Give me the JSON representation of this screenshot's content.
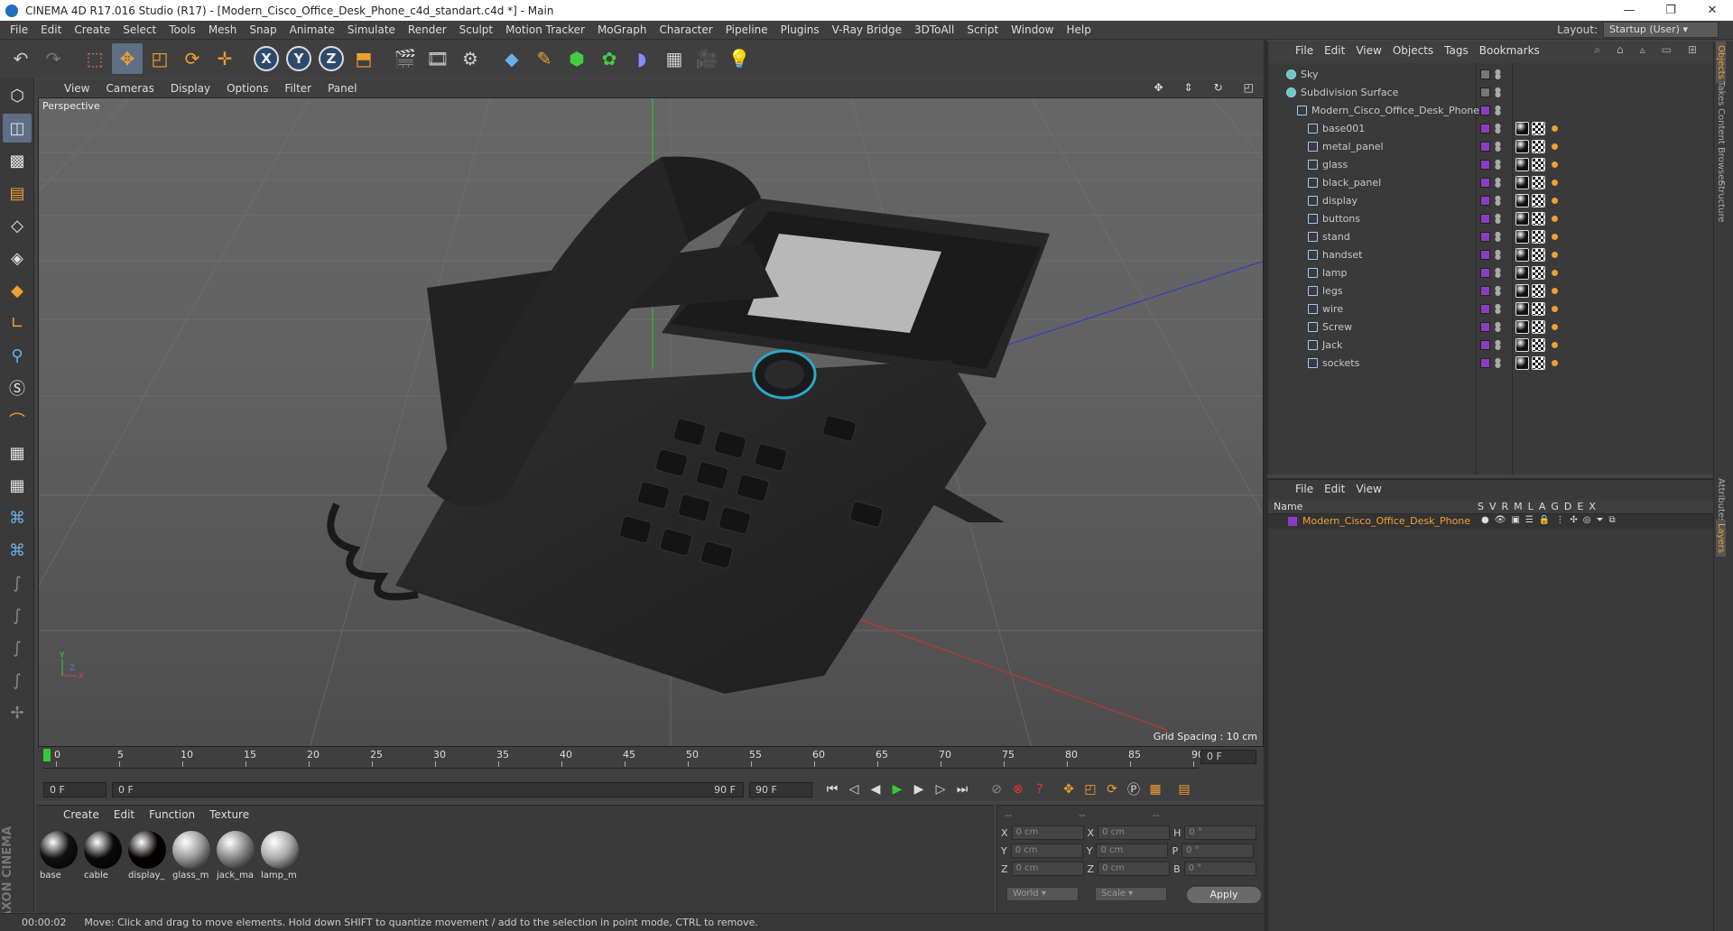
{
  "window": {
    "title": "CINEMA 4D R17.016 Studio (R17) - [Modern_Cisco_Office_Desk_Phone_c4d_standart.c4d *] - Main",
    "controls": [
      "—",
      "❐",
      "✕"
    ]
  },
  "menubar": {
    "items": [
      "File",
      "Edit",
      "Create",
      "Select",
      "Tools",
      "Mesh",
      "Snap",
      "Animate",
      "Simulate",
      "Render",
      "Sculpt",
      "Motion Tracker",
      "MoGraph",
      "Character",
      "Pipeline",
      "Plugins",
      "V-Ray Bridge",
      "3DToAll",
      "Script",
      "Window",
      "Help"
    ],
    "layout_label": "Layout:",
    "layout_value": "Startup (User)"
  },
  "toolbar": {
    "icons": [
      "undo-icon",
      "redo-icon",
      "live-select-icon",
      "move-icon",
      "scale-icon",
      "rotate-icon",
      "last-tool-icon",
      "x-axis-icon",
      "y-axis-icon",
      "z-axis-icon",
      "coordinate-system-icon",
      "render-view-icon",
      "render-picture-viewer-icon",
      "edit-render-settings-icon",
      "cube-icon",
      "pen-icon",
      "subdivision-icon",
      "cloner-icon",
      "deformer-icon",
      "floor-icon",
      "camera-icon",
      "light-icon"
    ],
    "axis_labels": [
      "X",
      "Y",
      "Z"
    ]
  },
  "viewport": {
    "menu": [
      "View",
      "Cameras",
      "Display",
      "Options",
      "Filter",
      "Panel"
    ],
    "label": "Perspective",
    "grid_spacing": "Grid Spacing : 10 cm"
  },
  "timeline": {
    "ticks": [
      "0",
      "5",
      "10",
      "15",
      "20",
      "25",
      "30",
      "35",
      "40",
      "45",
      "50",
      "55",
      "60",
      "65",
      "70",
      "75",
      "80",
      "85",
      "90"
    ],
    "current_frame": "0 F",
    "start_field": "0 F",
    "range_start": "0 F",
    "range_end": "90 F",
    "end_field": "90 F"
  },
  "materials": {
    "menu": [
      "Create",
      "Edit",
      "Function",
      "Texture"
    ],
    "items": [
      {
        "name": "base",
        "color": "#111"
      },
      {
        "name": "cable",
        "color": "#0a0a0a"
      },
      {
        "name": "display_",
        "color": "#050000"
      },
      {
        "name": "glass_m",
        "color": "#999"
      },
      {
        "name": "jack_ma",
        "color": "#888"
      },
      {
        "name": "lamp_m",
        "color": "#aaa"
      }
    ]
  },
  "coordinates": {
    "header": [
      "--",
      "--",
      "--"
    ],
    "rows": [
      {
        "a": "X",
        "av": "0 cm",
        "b": "X",
        "bv": "0 cm",
        "c": "H",
        "cv": "0 °"
      },
      {
        "a": "Y",
        "av": "0 cm",
        "b": "Y",
        "bv": "0 cm",
        "c": "P",
        "cv": "0 °"
      },
      {
        "a": "Z",
        "av": "0 cm",
        "b": "Z",
        "bv": "0 cm",
        "c": "B",
        "cv": "0 °"
      }
    ],
    "world": "World",
    "scale": "Scale",
    "apply": "Apply"
  },
  "status": {
    "time": "00:00:02",
    "message": "Move: Click and drag to move elements. Hold down SHIFT to quantize movement / add to the selection in point mode, CTRL to remove."
  },
  "object_manager": {
    "menu": [
      "File",
      "Edit",
      "View",
      "Objects",
      "Tags",
      "Bookmarks"
    ],
    "objects": [
      {
        "name": "Sky",
        "indent": 0,
        "color": "#777"
      },
      {
        "name": "Subdivision Surface",
        "indent": 0,
        "color": "#777"
      },
      {
        "name": "Modern_Cisco_Office_Desk_Phone",
        "indent": 1,
        "color": "#8c3cc4"
      },
      {
        "name": "base001",
        "indent": 2,
        "color": "#8c3cc4"
      },
      {
        "name": "metal_panel",
        "indent": 2,
        "color": "#8c3cc4"
      },
      {
        "name": "glass",
        "indent": 2,
        "color": "#8c3cc4"
      },
      {
        "name": "black_panel",
        "indent": 2,
        "color": "#8c3cc4"
      },
      {
        "name": "display",
        "indent": 2,
        "color": "#8c3cc4"
      },
      {
        "name": "buttons",
        "indent": 2,
        "color": "#8c3cc4"
      },
      {
        "name": "stand",
        "indent": 2,
        "color": "#8c3cc4"
      },
      {
        "name": "handset",
        "indent": 2,
        "color": "#8c3cc4"
      },
      {
        "name": "lamp",
        "indent": 2,
        "color": "#8c3cc4"
      },
      {
        "name": "legs",
        "indent": 2,
        "color": "#8c3cc4"
      },
      {
        "name": "wire",
        "indent": 2,
        "color": "#8c3cc4"
      },
      {
        "name": "Screw",
        "indent": 2,
        "color": "#8c3cc4"
      },
      {
        "name": "Jack",
        "indent": 2,
        "color": "#8c3cc4"
      },
      {
        "name": "sockets",
        "indent": 2,
        "color": "#8c3cc4"
      }
    ]
  },
  "layer_manager": {
    "menu": [
      "File",
      "Edit",
      "View"
    ],
    "header_name": "Name",
    "header_cols": [
      "S",
      "V",
      "R",
      "M",
      "L",
      "A",
      "G",
      "D",
      "E",
      "X"
    ],
    "layer": "Modern_Cisco_Office_Desk_Phone"
  },
  "right_tabs": [
    "Objects",
    "Takes",
    "Content Browser",
    "Structure",
    "Attributes",
    "Layers"
  ]
}
